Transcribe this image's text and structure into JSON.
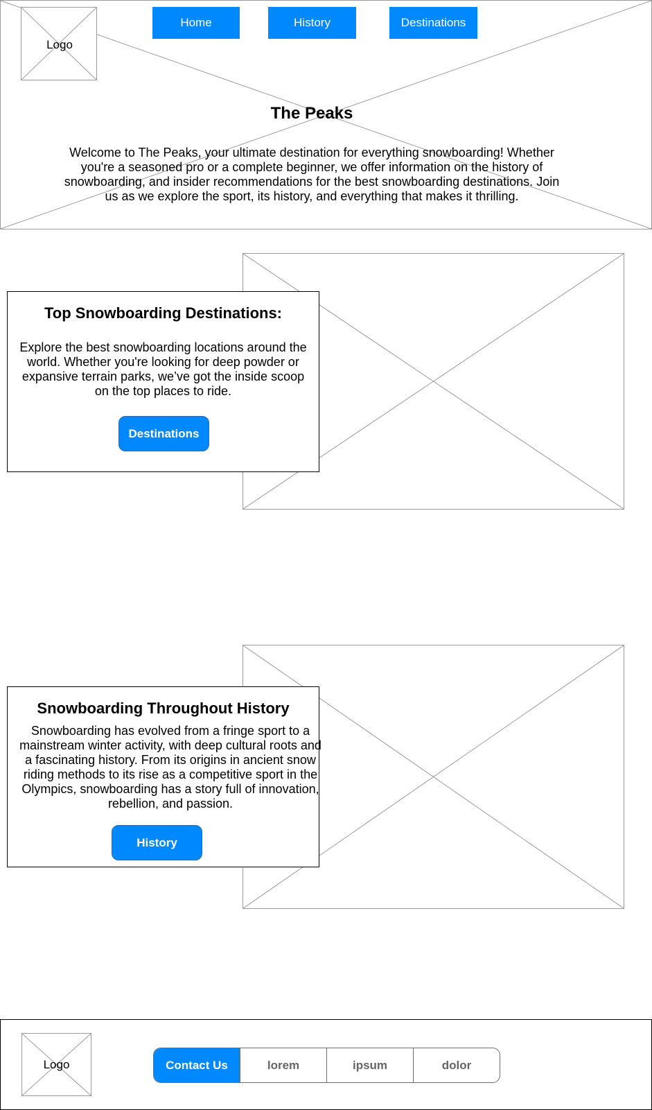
{
  "header": {
    "logo_label": "Logo",
    "nav": [
      {
        "label": "Home"
      },
      {
        "label": "History"
      },
      {
        "label": "Destinations"
      }
    ],
    "title": "The Peaks",
    "intro": "Welcome to The Peaks, your ultimate destination for everything snowboarding! Whether you're a seasoned pro or a complete beginner, we offer information on the history of snowboarding, and insider recommendations for the best snowboarding destinations. Join us as we explore the sport, its history, and everything that makes it thrilling."
  },
  "sections": [
    {
      "title": "Top Snowboarding Destinations:",
      "body": "Explore the best snowboarding locations around the world. Whether you're looking for deep powder or expansive terrain parks, we’ve got the inside scoop on the top places to ride.",
      "button_label": "Destinations"
    },
    {
      "title": "Snowboarding Throughout History",
      "body": "Snowboarding has evolved from a fringe sport to a mainstream winter activity, with deep cultural roots and a fascinating history. From its origins in ancient snow riding methods to its rise as a competitive sport in the Olympics, snowboarding has a story full of innovation, rebellion, and passion.",
      "button_label": "History"
    }
  ],
  "footer": {
    "logo_label": "Logo",
    "nav": [
      {
        "label": "Contact Us"
      },
      {
        "label": "lorem"
      },
      {
        "label": "ipsum"
      },
      {
        "label": "dolor"
      }
    ]
  },
  "colors": {
    "accent": "#0088ff",
    "placeholder_stroke": "#9a9a9a"
  }
}
